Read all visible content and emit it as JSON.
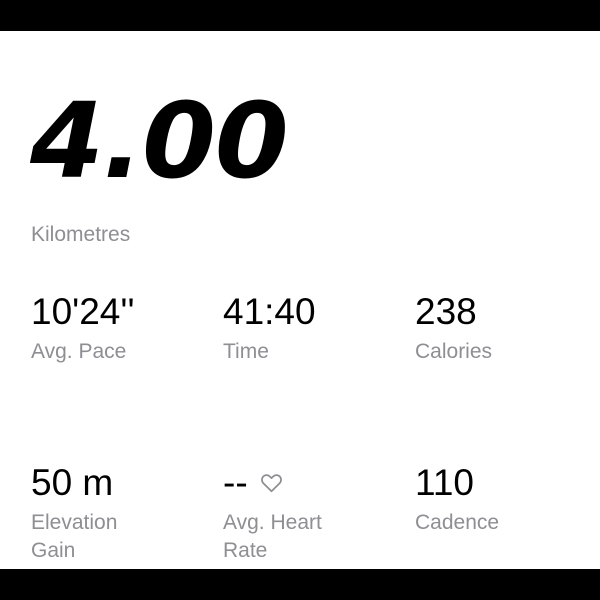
{
  "distance": {
    "value": "4.00",
    "unit": "Kilometres"
  },
  "stats": [
    {
      "value": "10'24''",
      "label": "Avg. Pace"
    },
    {
      "value": "41:40",
      "label": "Time"
    },
    {
      "value": "238",
      "label": "Calories"
    },
    {
      "value": "50 m",
      "label": "Elevation Gain"
    },
    {
      "value": "--",
      "label": "Avg. Heart Rate",
      "icon": "heart-outline-icon"
    },
    {
      "value": "110",
      "label": "Cadence"
    }
  ],
  "colors": {
    "background": "#FFFFFF",
    "frame": "#000000",
    "primary_text": "#000000",
    "secondary_text": "#8E8E93"
  }
}
